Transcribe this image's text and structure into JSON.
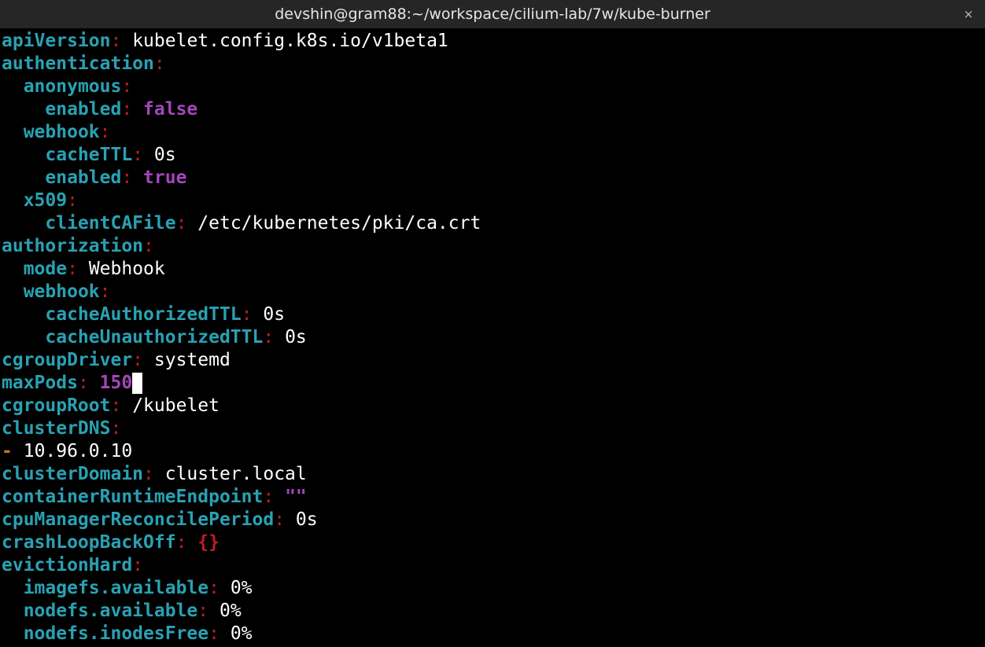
{
  "window": {
    "title": "devshin@gram88:~/workspace/cilium-lab/7w/kube-burner",
    "close_glyph": "×"
  },
  "colors": {
    "background": "#000000",
    "titlebar": "#262626",
    "key": "#2aa1b3",
    "colon": "#c01c28",
    "value": "#ffffff",
    "literal": "#a347ba",
    "dash": "#c17d11"
  },
  "lines": [
    {
      "indent": "",
      "key": "apiVersion",
      "value": "kubelet.config.k8s.io/v1beta1",
      "vtype": "val"
    },
    {
      "indent": "",
      "key": "authentication",
      "value": "",
      "vtype": "val"
    },
    {
      "indent": "  ",
      "key": "anonymous",
      "value": "",
      "vtype": "val"
    },
    {
      "indent": "    ",
      "key": "enabled",
      "value": "false",
      "vtype": "bool"
    },
    {
      "indent": "  ",
      "key": "webhook",
      "value": "",
      "vtype": "val"
    },
    {
      "indent": "    ",
      "key": "cacheTTL",
      "value": "0s",
      "vtype": "val"
    },
    {
      "indent": "    ",
      "key": "enabled",
      "value": "true",
      "vtype": "bool"
    },
    {
      "indent": "  ",
      "key": "x509",
      "value": "",
      "vtype": "val"
    },
    {
      "indent": "    ",
      "key": "clientCAFile",
      "value": "/etc/kubernetes/pki/ca.crt",
      "vtype": "val"
    },
    {
      "indent": "",
      "key": "authorization",
      "value": "",
      "vtype": "val"
    },
    {
      "indent": "  ",
      "key": "mode",
      "value": "Webhook",
      "vtype": "val"
    },
    {
      "indent": "  ",
      "key": "webhook",
      "value": "",
      "vtype": "val"
    },
    {
      "indent": "    ",
      "key": "cacheAuthorizedTTL",
      "value": "0s",
      "vtype": "val"
    },
    {
      "indent": "    ",
      "key": "cacheUnauthorizedTTL",
      "value": "0s",
      "vtype": "val"
    },
    {
      "indent": "",
      "key": "cgroupDriver",
      "value": "systemd",
      "vtype": "val"
    },
    {
      "indent": "",
      "key": "maxPods",
      "value": "150",
      "vtype": "num",
      "cursor": true
    },
    {
      "indent": "",
      "key": "cgroupRoot",
      "value": "/kubelet",
      "vtype": "val"
    },
    {
      "indent": "",
      "key": "clusterDNS",
      "value": "",
      "vtype": "val"
    },
    {
      "indent": "",
      "dash": "-",
      "value": "10.96.0.10",
      "vtype": "val"
    },
    {
      "indent": "",
      "key": "clusterDomain",
      "value": "cluster.local",
      "vtype": "val"
    },
    {
      "indent": "",
      "key": "containerRuntimeEndpoint",
      "value": "\"\"",
      "vtype": "str"
    },
    {
      "indent": "",
      "key": "cpuManagerReconcilePeriod",
      "value": "0s",
      "vtype": "val"
    },
    {
      "indent": "",
      "key": "crashLoopBackOff",
      "value": "{}",
      "vtype": "brace"
    },
    {
      "indent": "",
      "key": "evictionHard",
      "value": "",
      "vtype": "val"
    },
    {
      "indent": "  ",
      "key": "imagefs.available",
      "value": "0%",
      "vtype": "val"
    },
    {
      "indent": "  ",
      "key": "nodefs.available",
      "value": "0%",
      "vtype": "val"
    },
    {
      "indent": "  ",
      "key": "nodefs.inodesFree",
      "value": "0%",
      "vtype": "val"
    }
  ]
}
